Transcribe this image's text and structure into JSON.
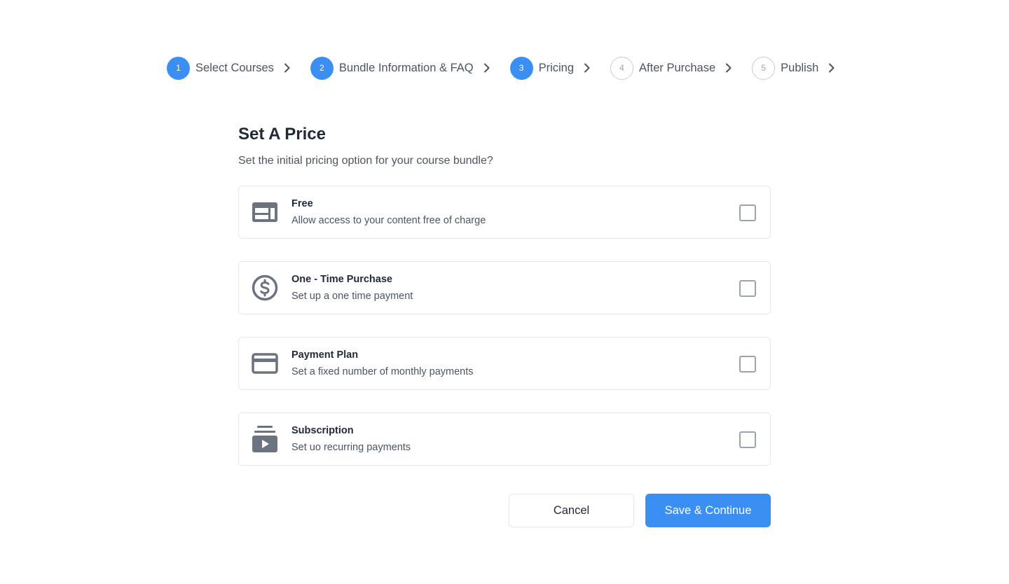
{
  "stepper": {
    "steps": [
      {
        "number": "1",
        "label": "Select Courses",
        "state": "active"
      },
      {
        "number": "2",
        "label": "Bundle Information & FAQ",
        "state": "active"
      },
      {
        "number": "3",
        "label": "Pricing",
        "state": "active"
      },
      {
        "number": "4",
        "label": "After Purchase",
        "state": "inactive"
      },
      {
        "number": "5",
        "label": "Publish",
        "state": "inactive"
      }
    ]
  },
  "main": {
    "title": "Set A Price",
    "subtitle": "Set the initial pricing option for your course bundle?",
    "options": [
      {
        "title": "Free",
        "description": "Allow access to your content free of charge",
        "icon": "layout-icon",
        "checked": false
      },
      {
        "title": "One - Time Purchase",
        "description": "Set up a one time payment",
        "icon": "dollar-icon",
        "checked": false
      },
      {
        "title": "Payment Plan",
        "description": "Set a fixed number of monthly payments",
        "icon": "credit-card-icon",
        "checked": false
      },
      {
        "title": "Subscription",
        "description": "Set uo recurring payments",
        "icon": "subscription-icon",
        "checked": false
      }
    ]
  },
  "actions": {
    "cancel_label": "Cancel",
    "save_label": "Save & Continue"
  },
  "colors": {
    "accent": "#3b8ff3",
    "icon": "#6b7280",
    "border": "#e5e7eb"
  }
}
